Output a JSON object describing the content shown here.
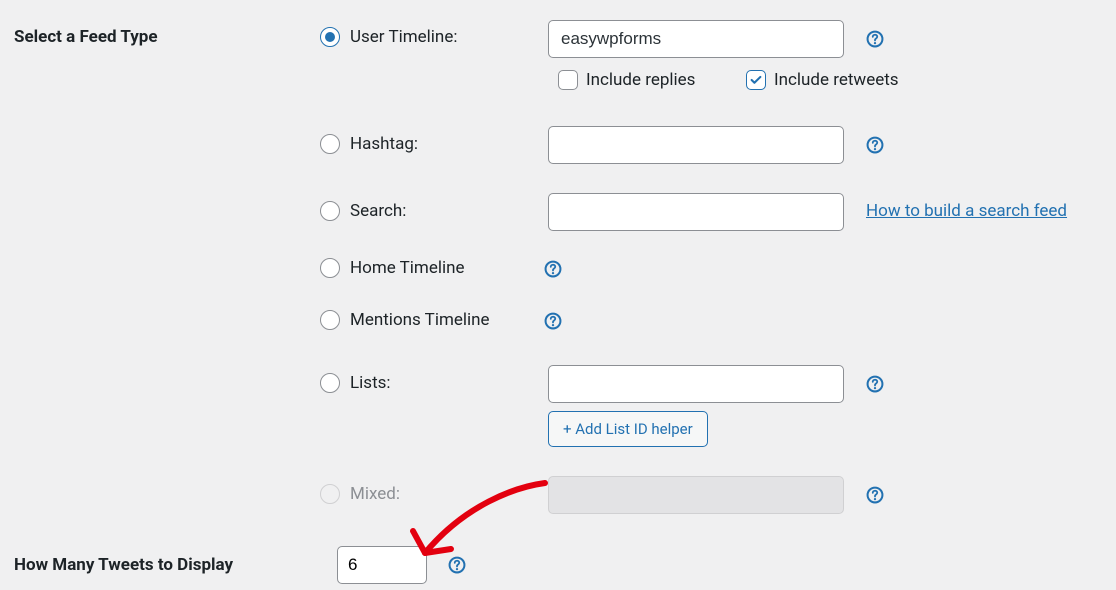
{
  "section1_label": "Select a Feed Type",
  "section2_label": "How Many Tweets to Display",
  "feed": {
    "user_timeline": {
      "label": "User Timeline:",
      "value": "easywpforms",
      "checked": true
    },
    "include_replies": {
      "label": "Include replies",
      "checked": false
    },
    "include_retweets": {
      "label": "Include retweets",
      "checked": true
    },
    "hashtag": {
      "label": "Hashtag:",
      "value": ""
    },
    "search": {
      "label": "Search:",
      "value": ""
    },
    "search_help_link": "How to build a search feed",
    "home_timeline": {
      "label": "Home Timeline"
    },
    "mentions_timeline": {
      "label": "Mentions Timeline"
    },
    "lists": {
      "label": "Lists:",
      "value": "",
      "button": "+ Add List ID helper"
    },
    "mixed": {
      "label": "Mixed:",
      "value": ""
    }
  },
  "tweet_count": "6"
}
